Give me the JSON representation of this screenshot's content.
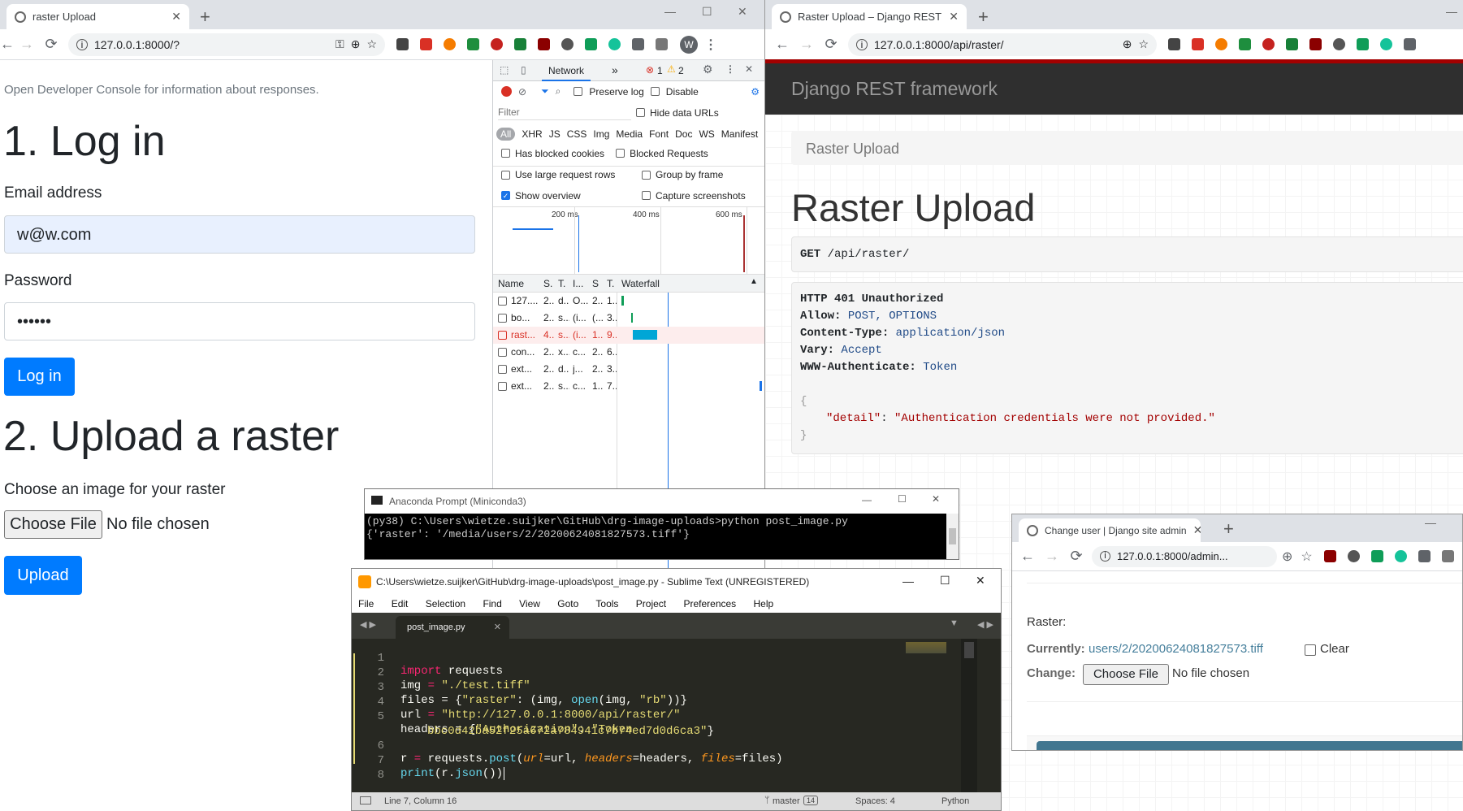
{
  "left_browser": {
    "tab_title": "raster Upload",
    "url": "127.0.0.1:8000/?",
    "page": {
      "hint": "Open Developer Console for information about responses.",
      "login_heading": "1. Log in",
      "email_label": "Email address",
      "email_value": "w@w.com",
      "password_label": "Password",
      "password_value": "••••••",
      "login_button": "Log in",
      "upload_heading": "2. Upload a raster",
      "choose_label": "Choose an image for your raster",
      "choose_button": "Choose File",
      "no_file": "No file chosen",
      "upload_button": "Upload"
    },
    "avatar": "W",
    "devtools": {
      "tab_network": "Network",
      "more_tabs": "»",
      "errors": "1",
      "warnings": "2",
      "preserve_log": "Preserve log",
      "disable_cache": "Disable",
      "filter_placeholder": "Filter",
      "hide_data_urls": "Hide data URLs",
      "types": [
        "All",
        "XHR",
        "JS",
        "CSS",
        "Img",
        "Media",
        "Font",
        "Doc",
        "WS",
        "Manifest"
      ],
      "has_blocked_cookies": "Has blocked cookies",
      "blocked_requests": "Blocked Requests",
      "large_rows": "Use large request rows",
      "group_by_frame": "Group by frame",
      "show_overview": "Show overview",
      "capture_screenshots": "Capture screenshots",
      "timeline_ticks": [
        "200 ms",
        "400 ms",
        "600 ms"
      ],
      "columns": [
        "Name",
        "S.",
        "T.",
        "I...",
        "S",
        "T.",
        "Waterfall"
      ],
      "rows": [
        {
          "name": "127....",
          "s": "2...",
          "t": "d...",
          "i": "O...",
          "sz": "2...",
          "tm": "1...",
          "red": false
        },
        {
          "name": "bo...",
          "s": "2...",
          "t": "s...",
          "i": "(i...",
          "sz": "(...",
          "tm": "3...",
          "red": false
        },
        {
          "name": "rast...",
          "s": "4...",
          "t": "s...",
          "i": "(i...",
          "sz": "1...",
          "tm": "9...",
          "red": true
        },
        {
          "name": "con...",
          "s": "2...",
          "t": "x...",
          "i": "c...",
          "sz": "2...",
          "tm": "6...",
          "red": false
        },
        {
          "name": "ext...",
          "s": "2...",
          "t": "d...",
          "i": "j...",
          "sz": "2...",
          "tm": "3...",
          "red": false
        },
        {
          "name": "ext...",
          "s": "2...",
          "t": "s...",
          "i": "c...",
          "sz": "1...",
          "tm": "7...",
          "red": false
        }
      ]
    }
  },
  "right_browser": {
    "tab_title": "Raster Upload – Django REST fra",
    "url": "127.0.0.1:8000/api/raster/",
    "brand": "Django REST framework",
    "breadcrumb": "Raster Upload",
    "heading": "Raster Upload",
    "request_method": "GET",
    "request_path": "/api/raster/",
    "response": {
      "status": "HTTP 401 Unauthorized",
      "allow_key": "Allow:",
      "allow_val": "POST, OPTIONS",
      "ctype_key": "Content-Type:",
      "ctype_val": "application/json",
      "vary_key": "Vary:",
      "vary_val": "Accept",
      "auth_key": "WWW-Authenticate:",
      "auth_val": "Token",
      "open_brace": "{",
      "detail_key": "\"detail\"",
      "colon": ":",
      "detail_val": "\"Authentication credentials were not provided.\"",
      "close_brace": "}"
    }
  },
  "anaconda": {
    "title": "Anaconda Prompt (Miniconda3)",
    "line1": "(py38) C:\\Users\\wietze.suijker\\GitHub\\drg-image-uploads>python post_image.py",
    "line2": "{'raster': '/media/users/2/20200624081827573.tiff'}"
  },
  "sublime": {
    "title": "C:\\Users\\wietze.suijker\\GitHub\\drg-image-uploads\\post_image.py - Sublime Text (UNREGISTERED)",
    "menu": [
      "File",
      "Edit",
      "Selection",
      "Find",
      "View",
      "Goto",
      "Tools",
      "Project",
      "Preferences",
      "Help"
    ],
    "tab": "post_image.py",
    "lines": {
      "l1a": "import",
      "l1b": " requests",
      "l2a": "img",
      "l2b": " = ",
      "l2c": "\"./test.tiff\"",
      "l3a": "files",
      "l3b": " = {",
      "l3c": "\"raster\"",
      "l3d": ": (img, ",
      "l3e": "open",
      "l3f": "(img, ",
      "l3g": "\"rb\"",
      "l3h": "))}",
      "l4a": "url",
      "l4b": " = ",
      "l4c": "\"http://127.0.0.1:8000/api/raster/\"",
      "l5a": "headers",
      "l5b": " = {",
      "l5c": "\"Authorization\"",
      "l5d": ": ",
      "l5e": "\"Token",
      "l5f": "bbc0d42ba52f25a672a784941c7b74ed7d0d6ca3\"",
      "l5g": "}",
      "l6a": "r",
      "l6b": " = ",
      "l6c": "requests.",
      "l6d": "post",
      "l6e": "(",
      "l6f": "url",
      "l6g": "=url, ",
      "l6h": "headers",
      "l6i": "=headers, ",
      "l6j": "files",
      "l6k": "=files)",
      "l7a": "print",
      "l7b": "(r.",
      "l7c": "json",
      "l7d": "())"
    },
    "line_numbers": [
      "1",
      "2",
      "3",
      "4",
      "5",
      "6",
      "7",
      "8"
    ],
    "status_pos": "Line 7, Column 16",
    "status_branch": "master",
    "status_branch_count": "14",
    "status_spaces": "Spaces: 4",
    "status_syntax": "Python"
  },
  "admin_browser": {
    "tab_title": "Change user | Django site admin",
    "url": "127.0.0.1:8000/admin...",
    "raster_label": "Raster:",
    "currently_label": "Currently:",
    "currently_link": "users/2/20200624081827573.tiff",
    "clear_label": "Clear",
    "change_label": "Change:",
    "choose_button": "Choose File",
    "no_file": "No file chosen"
  },
  "colors": {
    "primary": "#007bff",
    "drf_bar": "#2f2f2f",
    "drf_red": "#a30000",
    "monokai": "#272822"
  }
}
